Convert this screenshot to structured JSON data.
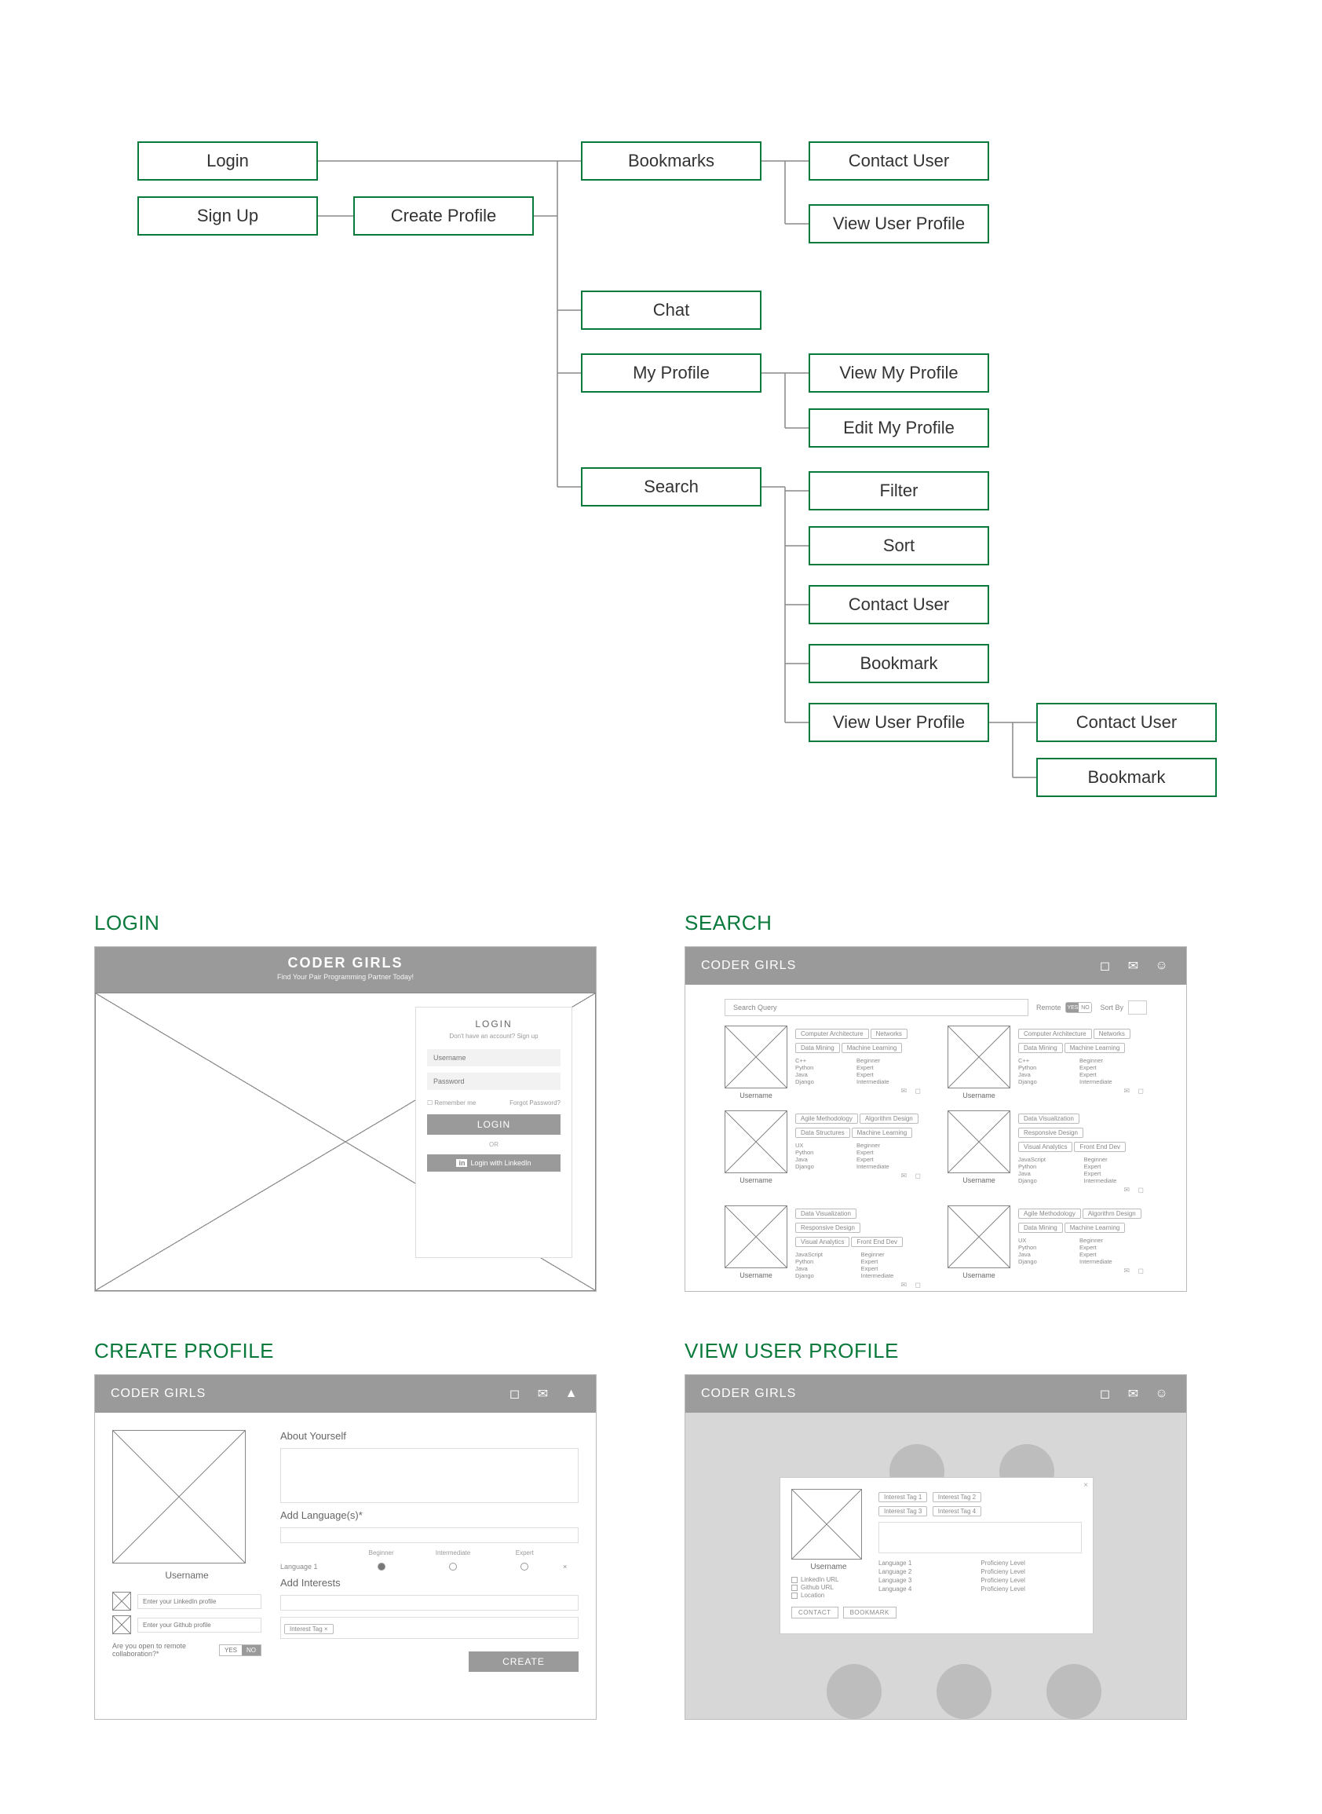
{
  "sitemap": {
    "login": "Login",
    "sign_up": "Sign Up",
    "create_profile": "Create Profile",
    "bookmarks": "Bookmarks",
    "chat": "Chat",
    "my_profile": "My Profile",
    "search": "Search",
    "contact_user": "Contact User",
    "view_user_profile": "View User Profile",
    "view_my_profile": "View My Profile",
    "edit_my_profile": "Edit My Profile",
    "filter": "Filter",
    "sort": "Sort",
    "bookmark": "Bookmark"
  },
  "wireframes": {
    "login": {
      "title": "LOGIN",
      "brand": "CODER GIRLS",
      "tagline": "Find Your Pair Programming Partner Today!",
      "panel_title": "LOGIN",
      "no_account": "Don't have an account? Sign up",
      "username_ph": "Username",
      "password_ph": "Password",
      "remember": "Remember me",
      "forgot": "Forgot Password?",
      "login_btn": "LOGIN",
      "or": "OR",
      "linkedin_btn": "Login with LinkedIn"
    },
    "search": {
      "title": "SEARCH",
      "brand": "CODER GIRLS",
      "query_ph": "Search Query",
      "remote_label": "Remote",
      "yes": "YES",
      "no": "NO",
      "sort_label": "Sort By",
      "username": "Username",
      "langs": [
        "C++",
        "Python",
        "Java",
        "Django",
        "UX",
        "Python",
        "JavaScript"
      ],
      "levels": [
        "Beginner",
        "Expert",
        "Expert",
        "Intermediate"
      ],
      "tags_a": [
        "Computer Architecture",
        "Networks",
        "Data Mining",
        "Machine Learning"
      ],
      "tags_b": [
        "Agile Methodology",
        "Algorithm Design",
        "Data Structures",
        "Machine Learning"
      ],
      "tags_c": [
        "Data Visualization",
        "Responsive Design",
        "Visual Analytics",
        "Front End Dev"
      ],
      "tags_d": [
        "Agile Methodology",
        "Algorithm Design",
        "Data Mining",
        "Machine Learning"
      ]
    },
    "create": {
      "title": "CREATE PROFILE",
      "brand": "CODER GIRLS",
      "username": "Username",
      "linkedin_ph": "Enter your LinkedIn profile",
      "github_ph": "Enter your Github profile",
      "remote_q": "Are you open to remote collaboration?*",
      "yes": "YES",
      "no": "NO",
      "about": "About Yourself",
      "add_lang": "Add Language(s)*",
      "lang1": "Language 1",
      "beginner": "Beginner",
      "intermediate": "Intermediate",
      "expert": "Expert",
      "add_interests": "Add Interests",
      "interest_tag": "Interest Tag  ×",
      "create_btn": "CREATE"
    },
    "view": {
      "title": "VIEW USER PROFILE",
      "brand": "CODER GIRLS",
      "username": "Username",
      "tags": [
        "Interest Tag 1",
        "Interest Tag 2",
        "Interest Tag 3",
        "Interest Tag 4"
      ],
      "linkedin": "LinkedIn URL",
      "github": "Github URL",
      "location": "Location",
      "lang": [
        "Language 1",
        "Language 2",
        "Language 3",
        "Language 4"
      ],
      "prof": "Proficieny Level",
      "contact": "CONTACT",
      "bookmark": "BOOKMARK"
    }
  }
}
